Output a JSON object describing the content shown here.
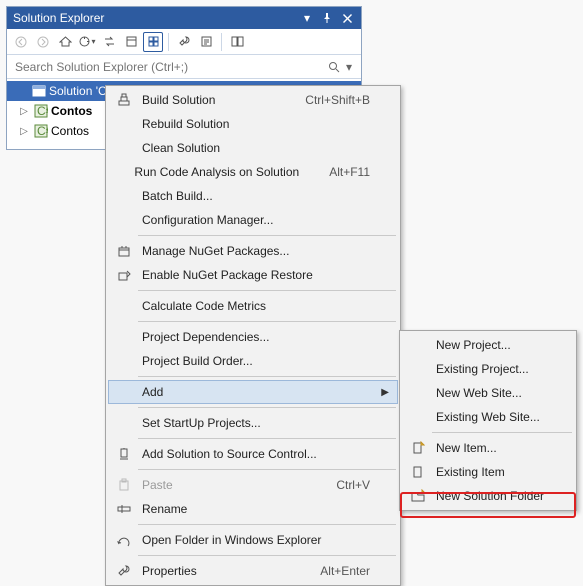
{
  "panel": {
    "title": "Solution Explorer",
    "search_placeholder": "Search Solution Explorer (Ctrl+;)"
  },
  "tree": {
    "solution": "Solution 'C",
    "proj1": "Contos",
    "proj2": "Contos"
  },
  "menu": {
    "build": "Build Solution",
    "build_sc": "Ctrl+Shift+B",
    "rebuild": "Rebuild Solution",
    "clean": "Clean Solution",
    "runanalysis": "Run Code Analysis on Solution",
    "runanalysis_sc": "Alt+F11",
    "batch": "Batch Build...",
    "config": "Configuration Manager...",
    "nuget": "Manage NuGet Packages...",
    "nuget_restore": "Enable NuGet Package Restore",
    "metrics": "Calculate Code Metrics",
    "deps": "Project Dependencies...",
    "order": "Project Build Order...",
    "add": "Add",
    "startup": "Set StartUp Projects...",
    "scc": "Add Solution to Source Control...",
    "paste": "Paste",
    "paste_sc": "Ctrl+V",
    "rename": "Rename",
    "openfolder": "Open Folder in Windows Explorer",
    "props": "Properties",
    "props_sc": "Alt+Enter"
  },
  "submenu": {
    "newproj": "New Project...",
    "exproj": "Existing Project...",
    "newsite": "New Web Site...",
    "exsite": "Existing Web Site...",
    "newitem": "New Item...",
    "exitem": "Existing Item",
    "newfolder": "New Solution Folder"
  }
}
